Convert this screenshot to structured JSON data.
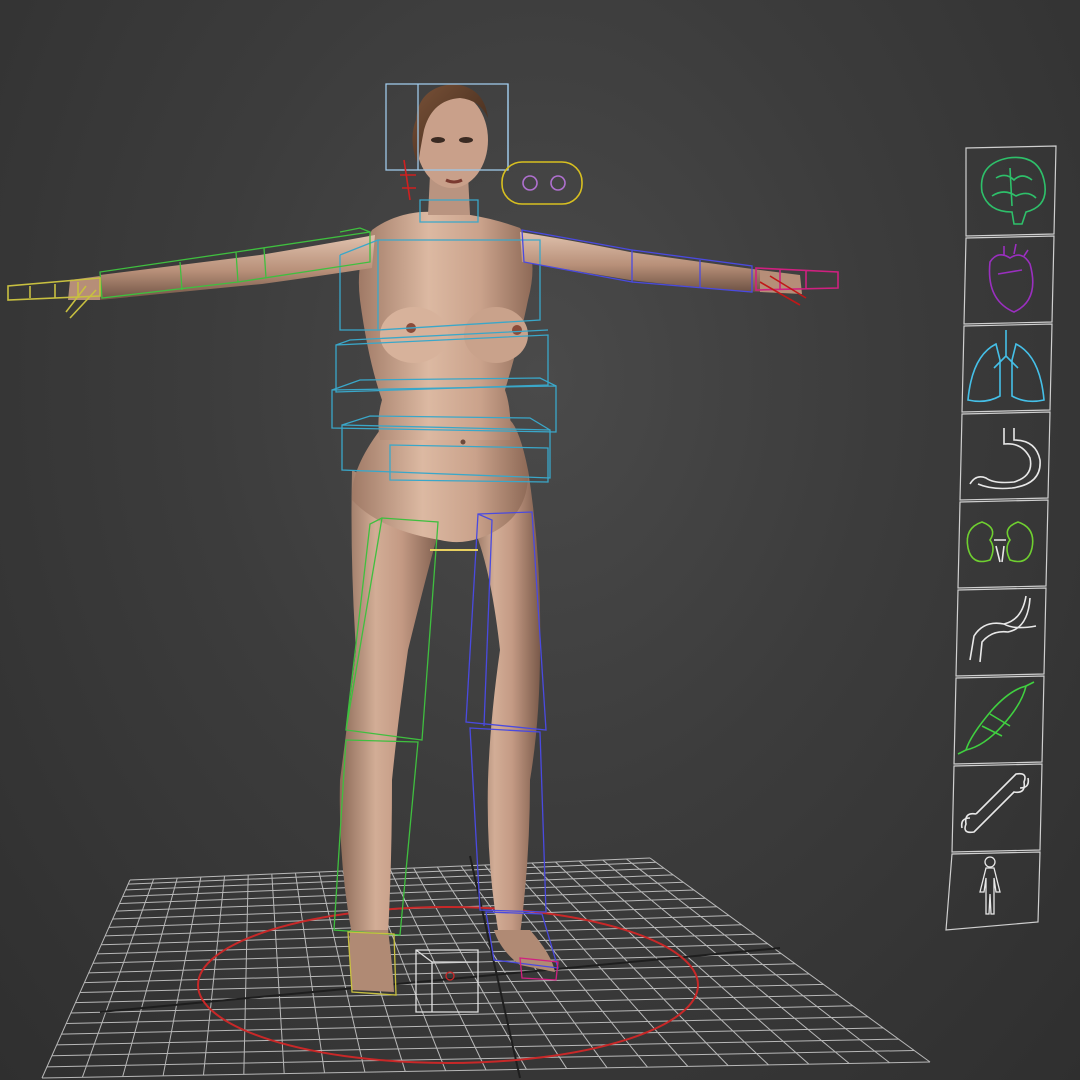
{
  "viewport": {
    "background": "#3c3c3c",
    "grid_color": "#cfcfcf",
    "grid_axis_color": "#1a1a1a"
  },
  "character": {
    "skin_color": "#c9a08a",
    "hair_color": "#5a3b28"
  },
  "rig": {
    "left_side_color": "#3fbf3f",
    "right_side_color": "#4a4ae0",
    "spine_color": "#3aa7c9",
    "head_color": "#9ec8e8",
    "eye_control_color": "#d8c020",
    "eye_target_color": "#b070d0",
    "left_hand_color": "#c8c040",
    "right_hand_color": "#d02080",
    "neck_control_color": "#d02020",
    "root_circle_color": "#c82828",
    "root_box_color": "#e0e0e0"
  },
  "anatomy_panel": {
    "items": [
      {
        "icon": "brain-icon",
        "color": "#2ec06a"
      },
      {
        "icon": "heart-icon",
        "color": "#9a2fbf"
      },
      {
        "icon": "lungs-icon",
        "color": "#45c0e8"
      },
      {
        "icon": "stomach-icon",
        "color": "#e8e8e8"
      },
      {
        "icon": "kidneys-icon",
        "color": "#6fd030"
      },
      {
        "icon": "intestine-icon",
        "color": "#e8e8e8"
      },
      {
        "icon": "muscle-icon",
        "color": "#40d040"
      },
      {
        "icon": "bone-icon",
        "color": "#e8e8e8"
      },
      {
        "icon": "full-body-icon",
        "color": "#e8e8e8"
      }
    ]
  }
}
